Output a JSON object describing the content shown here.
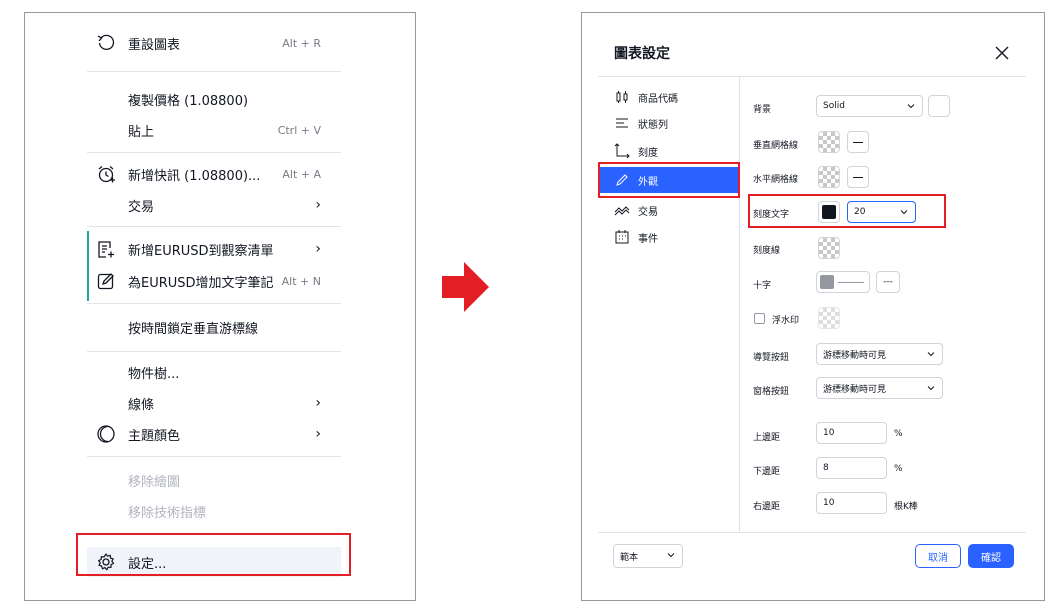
{
  "context_menu": {
    "items": [
      {
        "label": "重設圖表",
        "shortcut": "Alt + R"
      },
      {
        "label": "複製價格 (1.08800)"
      },
      {
        "label": "貼上",
        "shortcut": "Ctrl + V"
      },
      {
        "label": "新增快訊 (1.08800)...",
        "shortcut": "Alt + A"
      },
      {
        "label": "交易",
        "arrow": "›"
      },
      {
        "label": "新增EURUSD到觀察清單",
        "arrow": "›"
      },
      {
        "label": "為EURUSD增加文字筆記",
        "shortcut": "Alt + N"
      },
      {
        "label": "按時間鎖定垂直游標線"
      },
      {
        "label": "物件樹..."
      },
      {
        "label": "線條",
        "arrow": "›"
      },
      {
        "label": "主題顏色",
        "arrow": "›"
      },
      {
        "label": "移除繪圖"
      },
      {
        "label": "移除技術指標"
      },
      {
        "label": "設定..."
      }
    ]
  },
  "dialog": {
    "title": "圖表設定",
    "nav": [
      {
        "label": "商品代碼",
        "icon": "candles-icon"
      },
      {
        "label": "狀態列",
        "icon": "status-line-icon"
      },
      {
        "label": "刻度",
        "icon": "scales-icon"
      },
      {
        "label": "外觀",
        "icon": "pencil-icon",
        "active": true
      },
      {
        "label": "交易",
        "icon": "trading-icon"
      },
      {
        "label": "事件",
        "icon": "calendar-icon"
      }
    ],
    "settings": {
      "background": {
        "label": "背景",
        "value": "Solid"
      },
      "vert_grid": {
        "label": "垂直網格線"
      },
      "horz_grid": {
        "label": "水平網格線"
      },
      "scale_text": {
        "label": "刻度文字",
        "color": "#131722",
        "size": "20"
      },
      "scale_lines": {
        "label": "刻度線"
      },
      "crosshair": {
        "label": "十字",
        "line_style": "---"
      },
      "watermark": {
        "label": "浮水印"
      },
      "nav_buttons": {
        "label": "導覽按鈕",
        "value": "游標移動時可見"
      },
      "pane_buttons": {
        "label": "窗格按鈕",
        "value": "游標移動時可見"
      },
      "top_margin": {
        "label": "上邊距",
        "value": "10",
        "unit": "%"
      },
      "bottom_margin": {
        "label": "下邊距",
        "value": "8",
        "unit": "%"
      },
      "right_margin": {
        "label": "右邊距",
        "value": "10",
        "unit": "根K棒"
      }
    },
    "template": {
      "label": "範本"
    },
    "cancel_label": "取消",
    "ok_label": "確認"
  },
  "colors": {
    "accent": "#2962ff",
    "highlight": "#e31e24",
    "arrow": "#e31e24"
  }
}
